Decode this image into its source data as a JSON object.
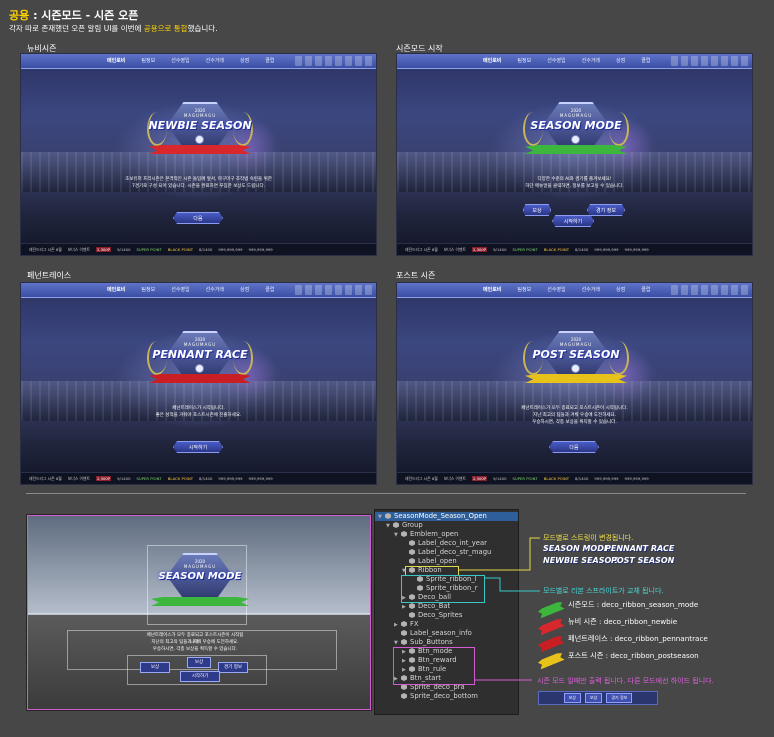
{
  "header": {
    "title_prefix": "공용",
    "title_rest": " : 시즌모드 - 시즌 오픈",
    "subtitle_a": "각자 따로 존재했던 오픈 알림 UI를 이번에 ",
    "subtitle_b": "공용으로 통합",
    "subtitle_c": "했습니다."
  },
  "panels": [
    {
      "label": "뉴비시즌",
      "mode_title": "NEWBIE SEASON",
      "ribbon_color": "#d8282d",
      "desc_lines": [
        "초보유저 프리시즌은 본격적인 시즌 돌입에 앞서, 마구마구 조작법 숙련을 위한",
        "7경기로 구성 되어 있습니다. 시즌을 완료하면 푸짐한 보상도 드립니다."
      ],
      "buttons": [
        "다음"
      ]
    },
    {
      "label": "시즌모드 시작",
      "mode_title": "SEASON MODE",
      "ribbon_color": "#3cb63c",
      "desc_lines": [
        "다양한 수준의 AI와 경기를 즐겨보세요!",
        "하단 메뉴얼을 클릭하면, 정보를 보고싶 수 있습니다."
      ],
      "buttons": [
        "보상",
        "경기 정보",
        "시작하기"
      ]
    },
    {
      "label": "페넌트레이스",
      "mode_title": "PENNANT RACE",
      "ribbon_color": "#c81e24",
      "desc_lines": [
        "페넌트레이스가 시작됩니다.",
        "좋은 성적을 거둬야 포스트시즌에 진출하세요."
      ],
      "buttons": [
        "시작하기"
      ]
    },
    {
      "label": "포스트 시즌",
      "mode_title": "POST SEASON",
      "ribbon_color": "#e6c21b",
      "desc_lines": [
        "페넌트레이스가 모두 종료되고 포스트시즌이 시작됩니다.",
        "지난 최고의 팀들과 겨뤄 우승에 도전하세요.",
        "우승하시면, 각종 보상을 획득할 수 있습니다."
      ],
      "buttons": [
        "다음"
      ]
    }
  ],
  "game_ui": {
    "tabs": [
      "메인로비",
      "팀정보",
      "선수영입",
      "선수거래",
      "상점",
      "클럽"
    ],
    "emblem_year": "2020",
    "emblem_brand": "MAGUMAGU",
    "bottombar": [
      "레전드리그 시즌 8월",
      "보너스 이벤트",
      "2,300P",
      "9/1400",
      "SUPER POINT",
      "BLACK POINT",
      "8/1400",
      "999,999,999",
      "999,999,999"
    ]
  },
  "scene": {
    "title": "SEASON MODE",
    "desc_lines": [
      "페넌트레이스가 모두 종료되고 포스트시즌이 시작됩니다.",
      "지난의 최고의 팀들과 겨뤄 우승에 도전하세요.",
      "우승하시면, 각종 보상을 획득할 수 있습니다."
    ],
    "buttons": [
      "보상",
      "보상",
      "경기 정보",
      "시작하기"
    ]
  },
  "tree": [
    {
      "label": "SeasonMode_Season_Open",
      "depth": 0,
      "arrow": "▼",
      "selected": true
    },
    {
      "label": "Group",
      "depth": 1,
      "arrow": "▼"
    },
    {
      "label": "Emblem_open",
      "depth": 2,
      "arrow": "▼"
    },
    {
      "label": "Label_deco_int_year",
      "depth": 3,
      "arrow": ""
    },
    {
      "label": "Label_deco_str_magu",
      "depth": 3,
      "arrow": ""
    },
    {
      "label": "Label_open",
      "depth": 3,
      "arrow": ""
    },
    {
      "label": "Ribbon",
      "depth": 3,
      "arrow": "▼"
    },
    {
      "label": "Sprite_ribbon_l",
      "depth": 4,
      "arrow": ""
    },
    {
      "label": "Sprite_ribbon_r",
      "depth": 4,
      "arrow": ""
    },
    {
      "label": "Deco_ball",
      "depth": 3,
      "arrow": "▶"
    },
    {
      "label": "Deco_Bat",
      "depth": 3,
      "arrow": "▶"
    },
    {
      "label": "Deco_Sprites",
      "depth": 3,
      "arrow": ""
    },
    {
      "label": "FX",
      "depth": 2,
      "arrow": "▶"
    },
    {
      "label": "Label_season_info",
      "depth": 2,
      "arrow": ""
    },
    {
      "label": "Sub_Buttons",
      "depth": 2,
      "arrow": "▼"
    },
    {
      "label": "Btn_mode",
      "depth": 3,
      "arrow": "▶"
    },
    {
      "label": "Btn_reward",
      "depth": 3,
      "arrow": "▶"
    },
    {
      "label": "Btn_rule",
      "depth": 3,
      "arrow": "▶"
    },
    {
      "label": "Btn_start",
      "depth": 2,
      "arrow": "▶"
    },
    {
      "label": "Sprite_deco_pra",
      "depth": 2,
      "arrow": ""
    },
    {
      "label": "Sprite_deco_bottom",
      "depth": 2,
      "arrow": ""
    }
  ],
  "notes": {
    "string_change": "모드별로 스트링이 변경됩니다.",
    "string_words": [
      "SEASON MODE",
      "PENNANT RACE",
      "NEWBIE SEASON",
      "POST SEASON"
    ],
    "ribbon_change": "모드별로 리본 스프라이트가 교체 됩니다.",
    "ribbons": [
      {
        "text": "시즌모드 : deco_ribbon_season_mode",
        "color": "#3cb63c"
      },
      {
        "text": "뉴비 시즌 : deco_ribbon_newbie",
        "color": "#d8282d"
      },
      {
        "text": "페넌트레이스 : deco_ribbon_pennantrace",
        "color": "#c81e24"
      },
      {
        "text": "포스트 시즌 : deco_ribbon_postseason",
        "color": "#e6c21b"
      }
    ],
    "sub_buttons": "시즌 모드 일때만 출력 됩니다. 다른 모드에선 하이드 됩니다.",
    "mini_buttons": [
      "보상",
      "보상",
      "경기 정보"
    ]
  },
  "colors": {
    "accent_yellow": "#ffd200",
    "note_yellow": "#f2e14a",
    "note_cyan": "#4ad8d8",
    "note_magenta": "#e060e0"
  }
}
